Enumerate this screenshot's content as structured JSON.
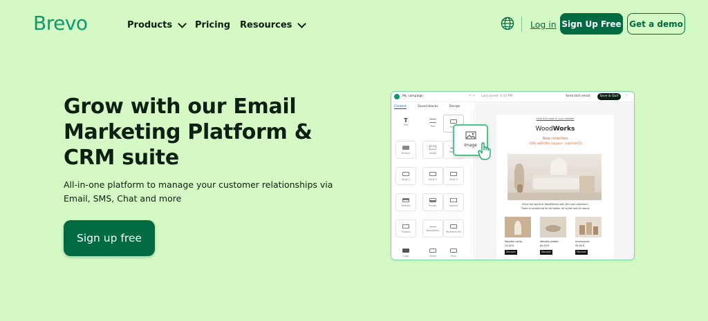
{
  "nav": {
    "logo": "Brevo",
    "links": [
      {
        "label": "Products",
        "dropdown": true
      },
      {
        "label": "Pricing",
        "dropdown": false
      },
      {
        "label": "Resources",
        "dropdown": true
      }
    ],
    "login": "Log in",
    "signup": "Sign Up Free",
    "demo": "Get a demo",
    "globe_icon": "globe-icon"
  },
  "hero": {
    "title": "Grow with our Email Marketing Platform & CRM suite",
    "subtitle": "All-in-one platform to manage your customer relationships via Email, SMS, Chat and more",
    "cta": "Sign up free"
  },
  "mockup": {
    "campaign": "My campaign",
    "last_saved": "Last saved: 4:20 PM",
    "send_test": "Send test email",
    "save_quit": "Save & Quit",
    "tabs": [
      "Content",
      "Saved blocks",
      "Design"
    ],
    "blocks": [
      "Title",
      "Text",
      "Image",
      "Button",
      "Social",
      "Divider",
      "Style 1",
      "Style 2",
      "Style 3",
      "Header",
      "Footer",
      "Spacer",
      "Product",
      "Navigation",
      "Payment link",
      "Logo",
      "Video",
      "Html"
    ],
    "drag_label": "Image",
    "email": {
      "view_online": "View this email in your browser",
      "brand_a": "Wood",
      "brand_b": "Works",
      "headline": "New collection",
      "promo": "-10% with the coupon : summer15",
      "body1": "Enter the world of WoodWorks with the new collection!",
      "body2": "There is something for all tastes, all styles and all rooms",
      "products": [
        {
          "name": "Wooden Lamp",
          "price": "23,00 €",
          "cta": "Discover"
        },
        {
          "name": "Wooden platter",
          "price": "8x,00 €",
          "cta": "Discover"
        },
        {
          "name": "Accessories",
          "price": "95,00 €",
          "cta": "Discover"
        }
      ]
    }
  },
  "colors": {
    "background": "#d5f9c4",
    "brand_green": "#006a43",
    "logo_green": "#0b996e",
    "accent_orange": "#e85a2a"
  }
}
